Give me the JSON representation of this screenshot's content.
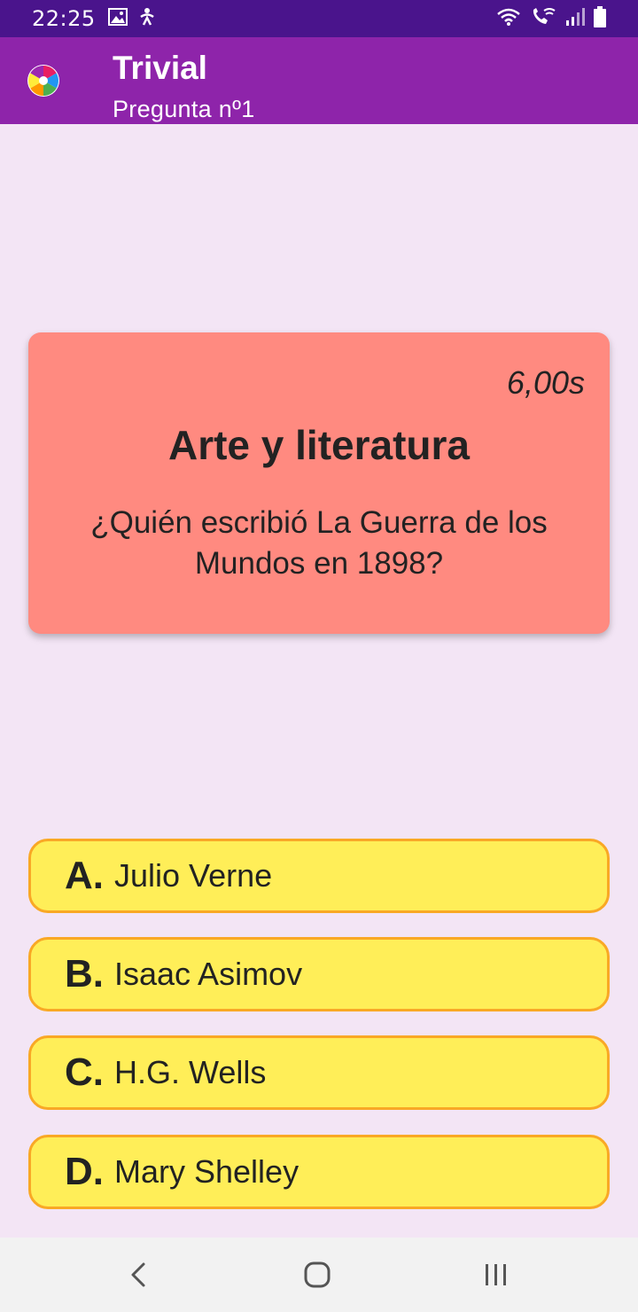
{
  "status_bar": {
    "time": "22:25",
    "left_icons": [
      "image-icon",
      "accessibility-icon"
    ],
    "right_icons": [
      "wifi-icon",
      "wifi-calling-icon",
      "signal-icon",
      "battery-icon"
    ]
  },
  "app_bar": {
    "title": "Trivial",
    "subtitle": "Pregunta nº1",
    "logo_icon": "trivial-wheel-icon"
  },
  "question": {
    "timer": "6,00s",
    "category": "Arte y literatura",
    "text": "¿Quién escribió La Guerra de los Mundos en 1898?",
    "card_color": "#ff8a80"
  },
  "answers": [
    {
      "letter": "A.",
      "text": "Julio Verne"
    },
    {
      "letter": "B.",
      "text": "Isaac Asimov"
    },
    {
      "letter": "C.",
      "text": "H.G. Wells"
    },
    {
      "letter": "D.",
      "text": "Mary Shelley"
    }
  ],
  "colors": {
    "status_bar": "#4a148c",
    "app_bar": "#8e24aa",
    "background": "#f3e5f5",
    "answer_fill": "#ffee58",
    "answer_border": "#f9a825"
  },
  "nav_bar": {
    "icons": [
      "back-icon",
      "home-icon",
      "recents-icon"
    ]
  }
}
